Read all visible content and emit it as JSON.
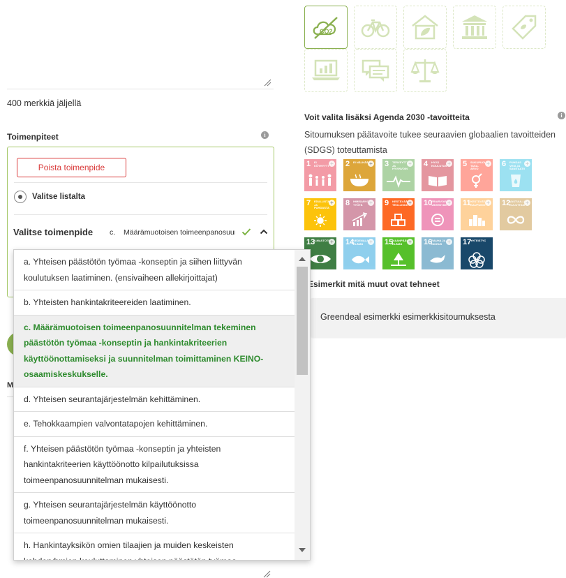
{
  "form": {
    "chars_left": "400 merkkiä jäljellä",
    "measures_label": "Toimenpiteet",
    "info_glyph": "i",
    "delete_button": "Poista toimenpide",
    "pick_from_list": "Valitse listalta",
    "select_label": "Valitse toimenpide",
    "selected_letter": "c.",
    "selected_value": "Määrämuotoisen toimeenpanosuunnitelman tekeminen",
    "partial_letter": "M"
  },
  "dropdown": {
    "options": [
      {
        "text": "a. Yhteisen päästötön työmaa -konseptin ja siihen liittyvän koulutuksen laatiminen. (ensivaiheen allekirjoittajat)",
        "selected": false
      },
      {
        "text": "b. Yhteisten hankintakriteereiden laatiminen.",
        "selected": false
      },
      {
        "text": "c. Määrämuotoisen toimeenpanosuunnitelman tekeminen päästötön työmaa -konseptin ja hankintakriteerien käyttöönottamiseksi ja suunnitelman toimittaminen KEINO-osaamiskeskukselle.",
        "selected": true
      },
      {
        "text": "d. Yhteisen seurantajärjestelmän kehittäminen.",
        "selected": false
      },
      {
        "text": "e. Tehokkaampien valvontatapojen kehittäminen.",
        "selected": false
      },
      {
        "text": "f. Yhteisen päästötön työmaa -konseptin ja yhteisten hankintakriteerien käyttöönotto kilpailutuksissa toimeenpanosuunnitelman mukaisesti.",
        "selected": false
      },
      {
        "text": "g. Yhteisen seurantajärjestelmän käyttöönotto toimeenpanosuunnitelman mukaisesti.",
        "selected": false
      },
      {
        "text": "h. Hankintayksikön omien tilaajien ja muiden keskeisten kohderyhmien kouluttaminen yhteisen päästötön työmaa -",
        "selected": false
      }
    ]
  },
  "theme_tiles": [
    {
      "icon": "co2-icon",
      "active": true
    },
    {
      "icon": "bicycle-icon",
      "active": false
    },
    {
      "icon": "house-leaf-icon",
      "active": false
    },
    {
      "icon": "public-building-icon",
      "active": false
    },
    {
      "icon": "price-tag-icon",
      "active": false
    },
    {
      "icon": "laptop-chart-icon",
      "active": false
    },
    {
      "icon": "chat-bubbles-icon",
      "active": false
    },
    {
      "icon": "scales-icon",
      "active": false
    }
  ],
  "agenda": {
    "title": "Voit valita lisäksi Agenda 2030 -tavoitteita",
    "description": "Sitoumuksen päätavoite tukee seuraavien globaalien tavoitteiden (SDGS) toteuttamista",
    "goals": [
      {
        "num": "1",
        "label": "Ei köyhyyttä",
        "color": "#e5243b",
        "faded": true
      },
      {
        "num": "2",
        "label": "Ei nälkää",
        "color": "#dda63a",
        "faded": false
      },
      {
        "num": "3",
        "label": "Terveyttä ja hyvinvointia",
        "color": "#4c9f38",
        "faded": true
      },
      {
        "num": "4",
        "label": "Hyvä koulutus",
        "color": "#c5192d",
        "faded": true
      },
      {
        "num": "5",
        "label": "Sukupuolten tasa-arvo",
        "color": "#ff3a21",
        "faded": true
      },
      {
        "num": "6",
        "label": "Puhdas vesi ja sanitaatio",
        "color": "#26bde2",
        "faded": true
      },
      {
        "num": "7",
        "label": "Edullista ja puhdasta energiaa",
        "color": "#fcc30b",
        "faded": false
      },
      {
        "num": "8",
        "label": "Ihmisarvoista työtä",
        "color": "#a21942",
        "faded": true
      },
      {
        "num": "9",
        "label": "Kestävää teollisuutta",
        "color": "#fd6925",
        "faded": false
      },
      {
        "num": "10",
        "label": "Eriarvoisuuden vähentäminen",
        "color": "#dd1367",
        "faded": true
      },
      {
        "num": "11",
        "label": "Kestävät kaupungit",
        "color": "#fd9d24",
        "faded": true
      },
      {
        "num": "12",
        "label": "Vastuullista kuluttamista",
        "color": "#bf8b2e",
        "faded": true
      },
      {
        "num": "13",
        "label": "Ilmastotekoja",
        "color": "#3f7e44",
        "faded": false
      },
      {
        "num": "14",
        "label": "Vedenalainen elämä",
        "color": "#0a97d9",
        "faded": true
      },
      {
        "num": "15",
        "label": "Maanpäällinen elämä",
        "color": "#56c02b",
        "faded": false
      },
      {
        "num": "16",
        "label": "Rauha ja oikeus",
        "color": "#00689d",
        "faded": true
      },
      {
        "num": "17",
        "label": "Yhteistyö",
        "color": "#19486a",
        "faded": false
      }
    ]
  },
  "examples": {
    "title": "Esimerkit mitä muut ovat tehneet",
    "item": "Greendeal esimerkki esimerkkisitoumuksesta"
  },
  "colors": {
    "accent_green": "#8ab050",
    "selected_text_green": "#2e8b2e",
    "delete_red": "#d93a3a"
  }
}
